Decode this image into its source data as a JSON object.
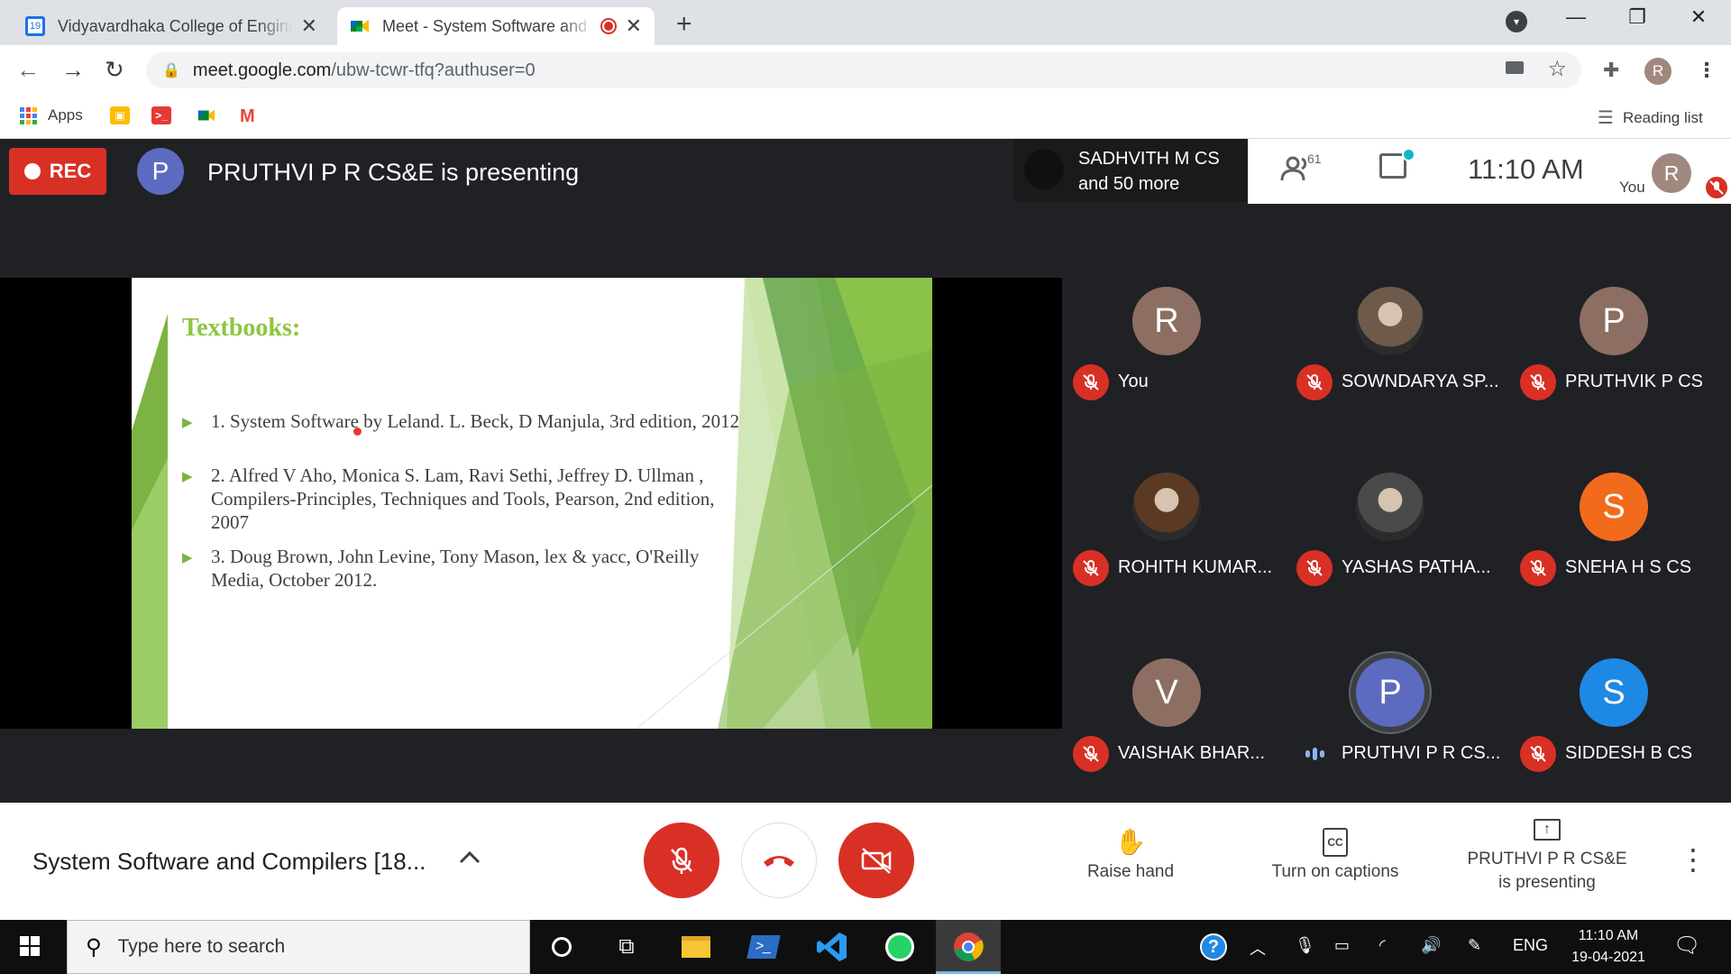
{
  "browser": {
    "tabs": [
      {
        "title": "Vidyavardhaka College of Engineering",
        "favicon": "calendar-icon",
        "favicon_text": "19",
        "active": false
      },
      {
        "title": "Meet - System Software and Compilers",
        "favicon": "meet-icon",
        "active": true,
        "recording": true
      }
    ],
    "url_domain": "meet.google.com",
    "url_path": "/ubw-tcwr-tfq?authuser=0",
    "bookmarks": [
      {
        "label": "Apps",
        "icon": "apps-grid-icon"
      },
      {
        "label": "",
        "icon": "classroom-icon"
      },
      {
        "label": "",
        "icon": "terminal-icon"
      },
      {
        "label": "",
        "icon": "meet-icon"
      },
      {
        "label": "",
        "icon": "gmail-icon"
      }
    ],
    "reading_list": "Reading list",
    "profile_initial": "R"
  },
  "meet": {
    "rec_label": "REC",
    "presenter_initial": "P",
    "presenting_title": "PRUTHVI P R CS&E is presenting",
    "speaker_line1": "SADHVITH M CS",
    "speaker_line2": "and 50 more",
    "people_count": "61",
    "clock": "11:10  AM",
    "you_label": "You",
    "self_initial": "R"
  },
  "slide": {
    "title": "Textbooks:",
    "items": [
      "1. System Software by Leland. L. Beck, D Manjula, 3rd edition, 2012",
      "2. Alfred V Aho, Monica S. Lam, Ravi Sethi, Jeffrey D. Ullman , Compilers-Principles, Techniques and Tools, Pearson, 2nd edition, 2007",
      "3. Doug Brown, John Levine, Tony Mason, lex & yacc, O'Reilly Media, October 2012."
    ],
    "accent_color": "#8cc63f"
  },
  "participants": [
    {
      "name": "You",
      "initial": "R",
      "color": "#8d6e63",
      "muted": true
    },
    {
      "name": "SOWNDARYA SP...",
      "initial": "",
      "color": "#6d5a4b",
      "muted": true,
      "photo": true
    },
    {
      "name": "PRUTHVIK P CS",
      "initial": "P",
      "color": "#8d6e63",
      "muted": true
    },
    {
      "name": "ROHITH KUMAR...",
      "initial": "",
      "color": "#5b3a24",
      "muted": true,
      "photo": true
    },
    {
      "name": "YASHAS PATHA...",
      "initial": "",
      "color": "#4a4a4a",
      "muted": true,
      "photo": true
    },
    {
      "name": "SNEHA H S CS",
      "initial": "S",
      "color": "#f26b1d",
      "muted": true
    },
    {
      "name": "VAISHAK BHAR...",
      "initial": "V",
      "color": "#8d6e63",
      "muted": true
    },
    {
      "name": "PRUTHVI P R CS...",
      "initial": "P",
      "color": "#5c6bc0",
      "muted": false,
      "speaking": true
    },
    {
      "name": "SIDDESH B CS",
      "initial": "S",
      "color": "#1e88e5",
      "muted": true
    }
  ],
  "bottom": {
    "meeting_title": "System Software and Compilers [18...",
    "raise_hand": "Raise hand",
    "captions": "Turn on captions",
    "present_line1": "PRUTHVI P R CS&E",
    "present_line2": "is presenting"
  },
  "taskbar": {
    "search_placeholder": "Type here to search",
    "language": "ENG",
    "time": "11:10 AM",
    "date": "19-04-2021"
  }
}
